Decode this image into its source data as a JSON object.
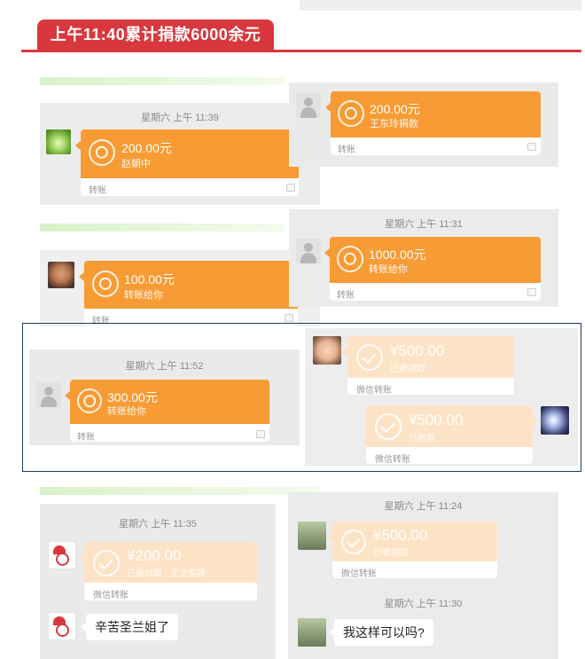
{
  "header": {
    "title": "上午11:40累计捐款6000余元"
  },
  "colors": {
    "header_red": "#d8383d",
    "transfer_orange": "#f79b34",
    "received_pale": "#fde3c6",
    "chat_bg": "#ececec"
  },
  "screenshots": [
    {
      "time": "星期六 上午 11:39",
      "amount": "200.00元",
      "from": "赵朝中",
      "footer": "转账"
    },
    {
      "amount": "200.00元",
      "from": "王东玲捐款",
      "footer": "转账"
    },
    {
      "amount": "100.00元",
      "from": "转账给你",
      "footer": "转账"
    },
    {
      "time": "星期六 上午 11:31",
      "amount": "1000.00元",
      "from": "转账给你",
      "footer": "转账"
    },
    {
      "time": "星期六 上午 11:52",
      "amount": "300.00元",
      "from": "转账给你",
      "footer": "转账"
    },
    {
      "amount_a": "¥500.00",
      "status_a": "已被领取",
      "footer_a": "微信转账",
      "amount_b": "¥500.00",
      "status_b": "已收款",
      "footer_b": "微信转账"
    },
    {
      "time": "星期六 上午 11:35",
      "amount": "¥200.00",
      "status": "已被领取 · 正文亮通",
      "footer": "微信转账",
      "message": "辛苦圣兰姐了"
    },
    {
      "time_a": "星期六 上午 11:24",
      "amount": "¥500.00",
      "status": "已被领取",
      "footer": "微信转账",
      "time_b": "星期六 上午 11:30",
      "message": "我这样可以吗?"
    }
  ]
}
